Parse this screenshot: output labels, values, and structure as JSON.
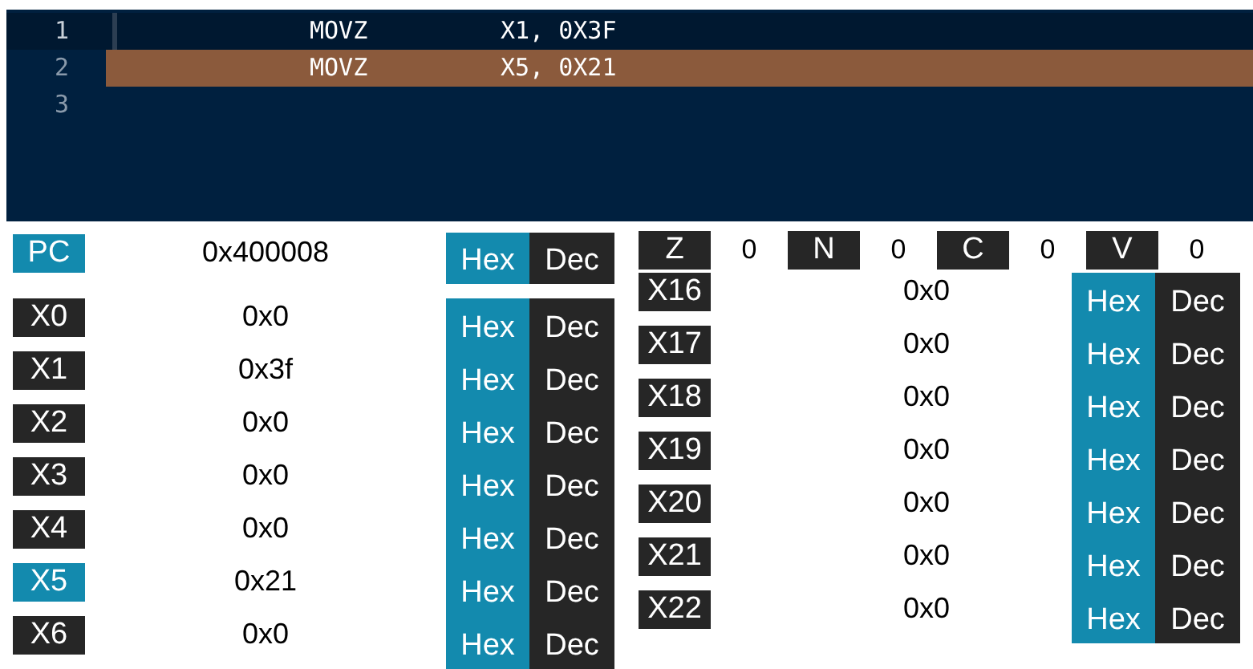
{
  "editor": {
    "lines": [
      {
        "number": "1",
        "mnemonic": "MOVZ",
        "operands": "X1, 0X3F",
        "current": true,
        "highlighted": false
      },
      {
        "number": "2",
        "mnemonic": "MOVZ",
        "operands": "X5, 0X21",
        "current": false,
        "highlighted": true
      },
      {
        "number": "3",
        "current": false,
        "highlighted": false
      }
    ]
  },
  "pc": {
    "label": "PC",
    "value": "0x400008",
    "highlighted": true,
    "format": [
      {
        "label": "Hex",
        "selected": true
      },
      {
        "label": "Dec",
        "selected": false
      }
    ]
  },
  "flags": [
    {
      "label": "Z",
      "value": "0"
    },
    {
      "label": "N",
      "value": "0"
    },
    {
      "label": "C",
      "value": "0"
    },
    {
      "label": "V",
      "value": "0"
    }
  ],
  "registers_left": [
    {
      "label": "X0",
      "value": "0x0",
      "highlighted": false,
      "format": [
        {
          "label": "Hex",
          "selected": true
        },
        {
          "label": "Dec",
          "selected": false
        }
      ]
    },
    {
      "label": "X1",
      "value": "0x3f",
      "highlighted": false,
      "format": [
        {
          "label": "Hex",
          "selected": true
        },
        {
          "label": "Dec",
          "selected": false
        }
      ]
    },
    {
      "label": "X2",
      "value": "0x0",
      "highlighted": false,
      "format": [
        {
          "label": "Hex",
          "selected": true
        },
        {
          "label": "Dec",
          "selected": false
        }
      ]
    },
    {
      "label": "X3",
      "value": "0x0",
      "highlighted": false,
      "format": [
        {
          "label": "Hex",
          "selected": true
        },
        {
          "label": "Dec",
          "selected": false
        }
      ]
    },
    {
      "label": "X4",
      "value": "0x0",
      "highlighted": false,
      "format": [
        {
          "label": "Hex",
          "selected": true
        },
        {
          "label": "Dec",
          "selected": false
        }
      ]
    },
    {
      "label": "X5",
      "value": "0x21",
      "highlighted": true,
      "format": [
        {
          "label": "Hex",
          "selected": true
        },
        {
          "label": "Dec",
          "selected": false
        }
      ]
    },
    {
      "label": "X6",
      "value": "0x0",
      "highlighted": false,
      "format": [
        {
          "label": "Hex",
          "selected": true
        },
        {
          "label": "Dec",
          "selected": false
        }
      ]
    }
  ],
  "registers_right": [
    {
      "label": "X16",
      "value": "0x0",
      "highlighted": false,
      "format": [
        {
          "label": "Hex",
          "selected": true
        },
        {
          "label": "Dec",
          "selected": false
        }
      ]
    },
    {
      "label": "X17",
      "value": "0x0",
      "highlighted": false,
      "format": [
        {
          "label": "Hex",
          "selected": true
        },
        {
          "label": "Dec",
          "selected": false
        }
      ]
    },
    {
      "label": "X18",
      "value": "0x0",
      "highlighted": false,
      "format": [
        {
          "label": "Hex",
          "selected": true
        },
        {
          "label": "Dec",
          "selected": false
        }
      ]
    },
    {
      "label": "X19",
      "value": "0x0",
      "highlighted": false,
      "format": [
        {
          "label": "Hex",
          "selected": true
        },
        {
          "label": "Dec",
          "selected": false
        }
      ]
    },
    {
      "label": "X20",
      "value": "0x0",
      "highlighted": false,
      "format": [
        {
          "label": "Hex",
          "selected": true
        },
        {
          "label": "Dec",
          "selected": false
        }
      ]
    },
    {
      "label": "X21",
      "value": "0x0",
      "highlighted": false,
      "format": [
        {
          "label": "Hex",
          "selected": true
        },
        {
          "label": "Dec",
          "selected": false
        }
      ]
    },
    {
      "label": "X22",
      "value": "0x0",
      "highlighted": false,
      "format": [
        {
          "label": "Hex",
          "selected": true
        },
        {
          "label": "Dec",
          "selected": false
        }
      ]
    }
  ]
}
